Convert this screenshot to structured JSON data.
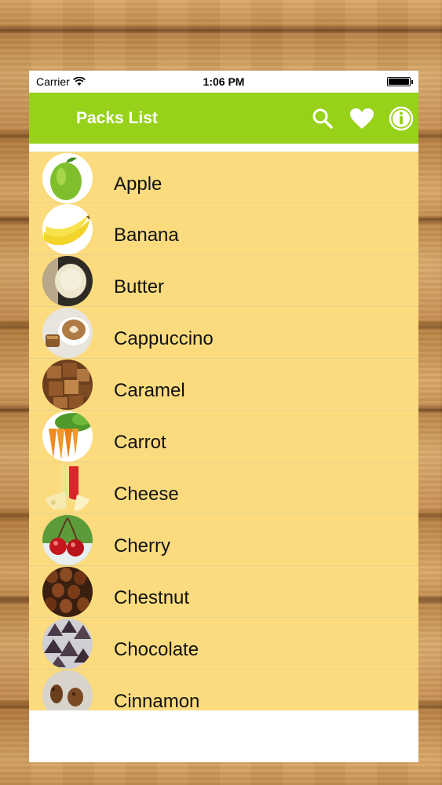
{
  "status_bar": {
    "carrier": "Carrier",
    "time": "1:06 PM"
  },
  "navbar": {
    "title": "Packs List",
    "icons": [
      "search-icon",
      "heart-icon",
      "info-icon"
    ]
  },
  "colors": {
    "navbar": "#97d11a",
    "list_background": "#fbdb7e",
    "text": "#111111"
  },
  "items": [
    {
      "label": "Apple",
      "thumb": "apple"
    },
    {
      "label": "Banana",
      "thumb": "banana"
    },
    {
      "label": "Butter",
      "thumb": "butter"
    },
    {
      "label": "Cappuccino",
      "thumb": "cappuccino"
    },
    {
      "label": "Caramel",
      "thumb": "caramel"
    },
    {
      "label": "Carrot",
      "thumb": "carrot"
    },
    {
      "label": "Cheese",
      "thumb": "cheese"
    },
    {
      "label": "Cherry",
      "thumb": "cherry"
    },
    {
      "label": "Chestnut",
      "thumb": "chestnut"
    },
    {
      "label": "Chocolate",
      "thumb": "chocolate"
    },
    {
      "label": "Cinnamon",
      "thumb": "cinnamon"
    }
  ]
}
